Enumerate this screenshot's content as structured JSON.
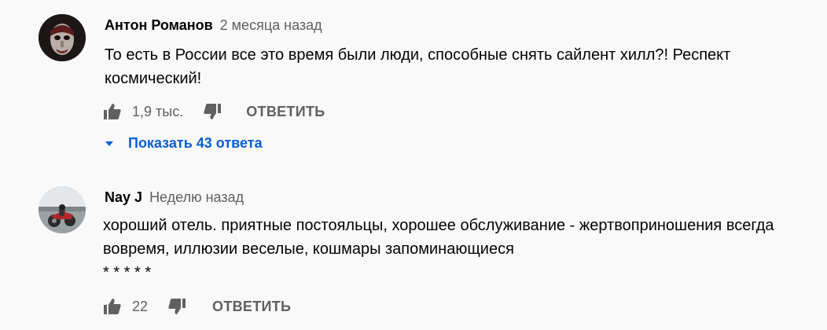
{
  "comments": [
    {
      "author": "Антон Романов",
      "time": "2 месяца назад",
      "text": "То есть в России все это время были люди, способные снять сайлент хилл?! Респект космический!",
      "likes": "1,9 тыс.",
      "reply_label": "ОТВЕТИТЬ",
      "replies_label": "Показать 43 ответа",
      "avatar_icon": "dark-masked-face-avatar"
    },
    {
      "author": "Nay J",
      "time": "Неделю назад",
      "text": "хороший отель. приятные постояльцы, хорошее обслуживание - жертвоприношения всегда вовремя, иллюзии веселые, кошмары запоминающиеся\n* * * * *",
      "likes": "22",
      "reply_label": "ОТВЕТИТЬ",
      "avatar_icon": "motorcycle-photo-avatar"
    }
  ],
  "colors": {
    "background": "#f9f9f9",
    "link_blue": "#065fd4",
    "secondary_text": "#606060",
    "icon_gray": "#606060"
  }
}
